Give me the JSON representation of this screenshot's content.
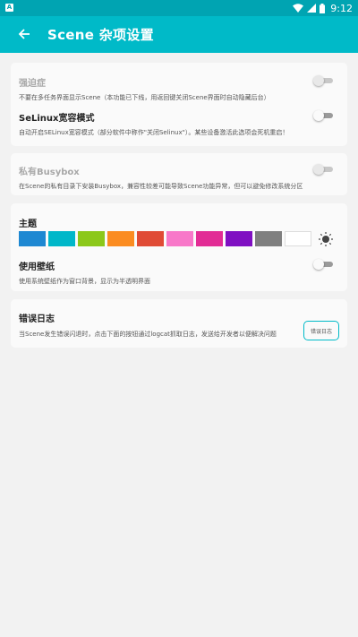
{
  "status_bar": {
    "time": "9:12",
    "icons": [
      "wifi-icon",
      "signal-icon",
      "battery-icon"
    ]
  },
  "toolbar": {
    "title": "Scene 杂项设置",
    "back_icon": "arrow-left-icon"
  },
  "settings": {
    "ocd": {
      "label": "强迫症",
      "desc": "不要在多任务界面显示Scene（本功能已下线，用返回键关闭Scene界面时自动隐藏后台）",
      "enabled": false,
      "checked": false
    },
    "selinux": {
      "label": "SeLinux宽容模式",
      "desc": "自动开启SELinux宽容模式（部分软件中称作\"关闭Selinux\"）。某些设备激活此选项会死机重启！",
      "enabled": true,
      "checked": false
    },
    "busybox": {
      "label": "私有Busybox",
      "desc": "在Scene的私有目录下安装Busybox，兼容性较差可能导致Scene功能异常，但可以避免修改系统分区",
      "enabled": false,
      "checked": false
    },
    "theme": {
      "label": "主题",
      "colors": [
        "#1e88d2",
        "#00b7c9",
        "#8cc81a",
        "#fb8c21",
        "#e04b35",
        "#f878c9",
        "#e22c95",
        "#7f0fc2",
        "#7f7f7f",
        "#ffffff"
      ],
      "mode_icon": "sun-icon"
    },
    "wallpaper": {
      "label": "使用壁纸",
      "desc": "使用系统壁纸作为窗口背景，显示为半透明界面",
      "enabled": true,
      "checked": false
    },
    "error_log": {
      "label": "错误日志",
      "desc": "当Scene发生错误闪退时，点击下面的按钮通过logcat抓取日志，发送给开发者以便解决问题",
      "button": "错误日志"
    }
  }
}
